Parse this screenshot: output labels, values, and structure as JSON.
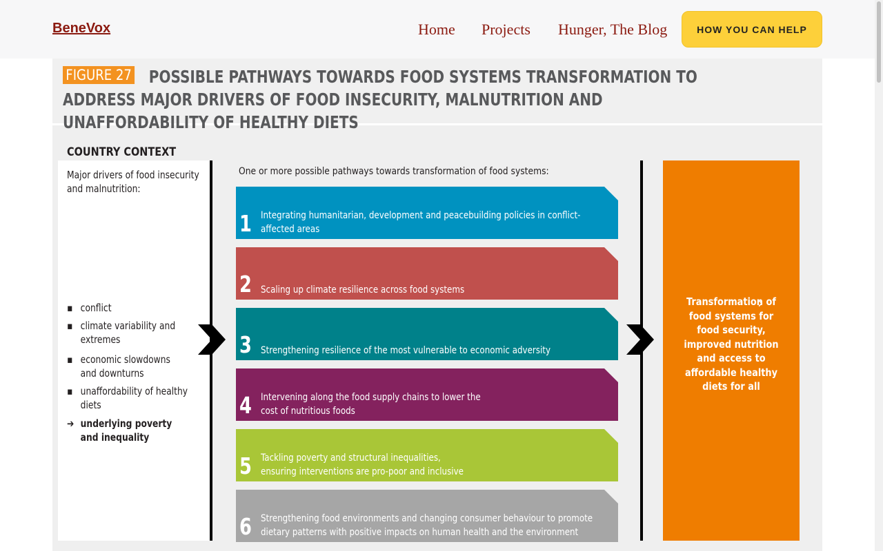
{
  "header": {
    "logo": "BeneVox",
    "nav": {
      "home": "Home",
      "projects": "Projects",
      "blog": "Hunger, The Blog"
    },
    "cta": "HOW YOU CAN HELP"
  },
  "figure": {
    "label": "FIGURE 27",
    "title": "POSSIBLE PATHWAYS TOWARDS FOOD SYSTEMS TRANSFORMATION TO ADDRESS MAJOR DRIVERS OF FOOD INSECURITY, MALNUTRITION AND UNAFFORDABILITY OF HEALTHY DIETS",
    "context": {
      "title": "COUNTRY CONTEXT",
      "subtitle": "Major drivers of food insecurity and malnutrition:",
      "items": [
        {
          "bullet": "▪",
          "text": "conflict"
        },
        {
          "bullet": "▪",
          "text": "climate variability and extremes"
        },
        {
          "bullet": "▪",
          "text": "economic slowdowns and downturns"
        },
        {
          "bullet": "▪",
          "text": "unaffordability of healthy diets"
        },
        {
          "bullet": "➔",
          "text": "underlying poverty and inequality"
        }
      ]
    },
    "pathways_intro": "One or more possible pathways towards transformation of food systems:",
    "pathways": [
      {
        "number": "1",
        "text": "Integrating humanitarian, development and peacebuilding policies in conflict-affected areas",
        "color": "#0092c0"
      },
      {
        "number": "2",
        "text": "Scaling up climate resilience across food systems",
        "color": "#c0504d"
      },
      {
        "number": "3",
        "text": "Strengthening resilience of the most vulnerable to economic adversity",
        "color": "#00818a"
      },
      {
        "number": "4",
        "text": "Intervening along the food supply chains to lower the cost of nutritious foods",
        "color": "#84225e"
      },
      {
        "number": "5",
        "text": "Tackling poverty and structural inequalities, ensuring interventions are pro-poor and inclusive",
        "color": "#a9c637"
      },
      {
        "number": "6",
        "text": "Strengthening food environments and changing consumer behaviour to promote dietary patterns with positive  impacts on human health and the environment",
        "color": "#a6a6a6"
      }
    ],
    "outcome": "Transformation of food systems for food security, improved nutrition and access to affordable healthy diets for all",
    "outcome_color": "#ef7d00"
  },
  "colors": {
    "link": "#8b1a10",
    "cta_bg": "#fdd03a",
    "label_bg": "#f39220"
  },
  "icons": {
    "next": "chevron-right-icon",
    "flow": "double-chevron-icon"
  }
}
